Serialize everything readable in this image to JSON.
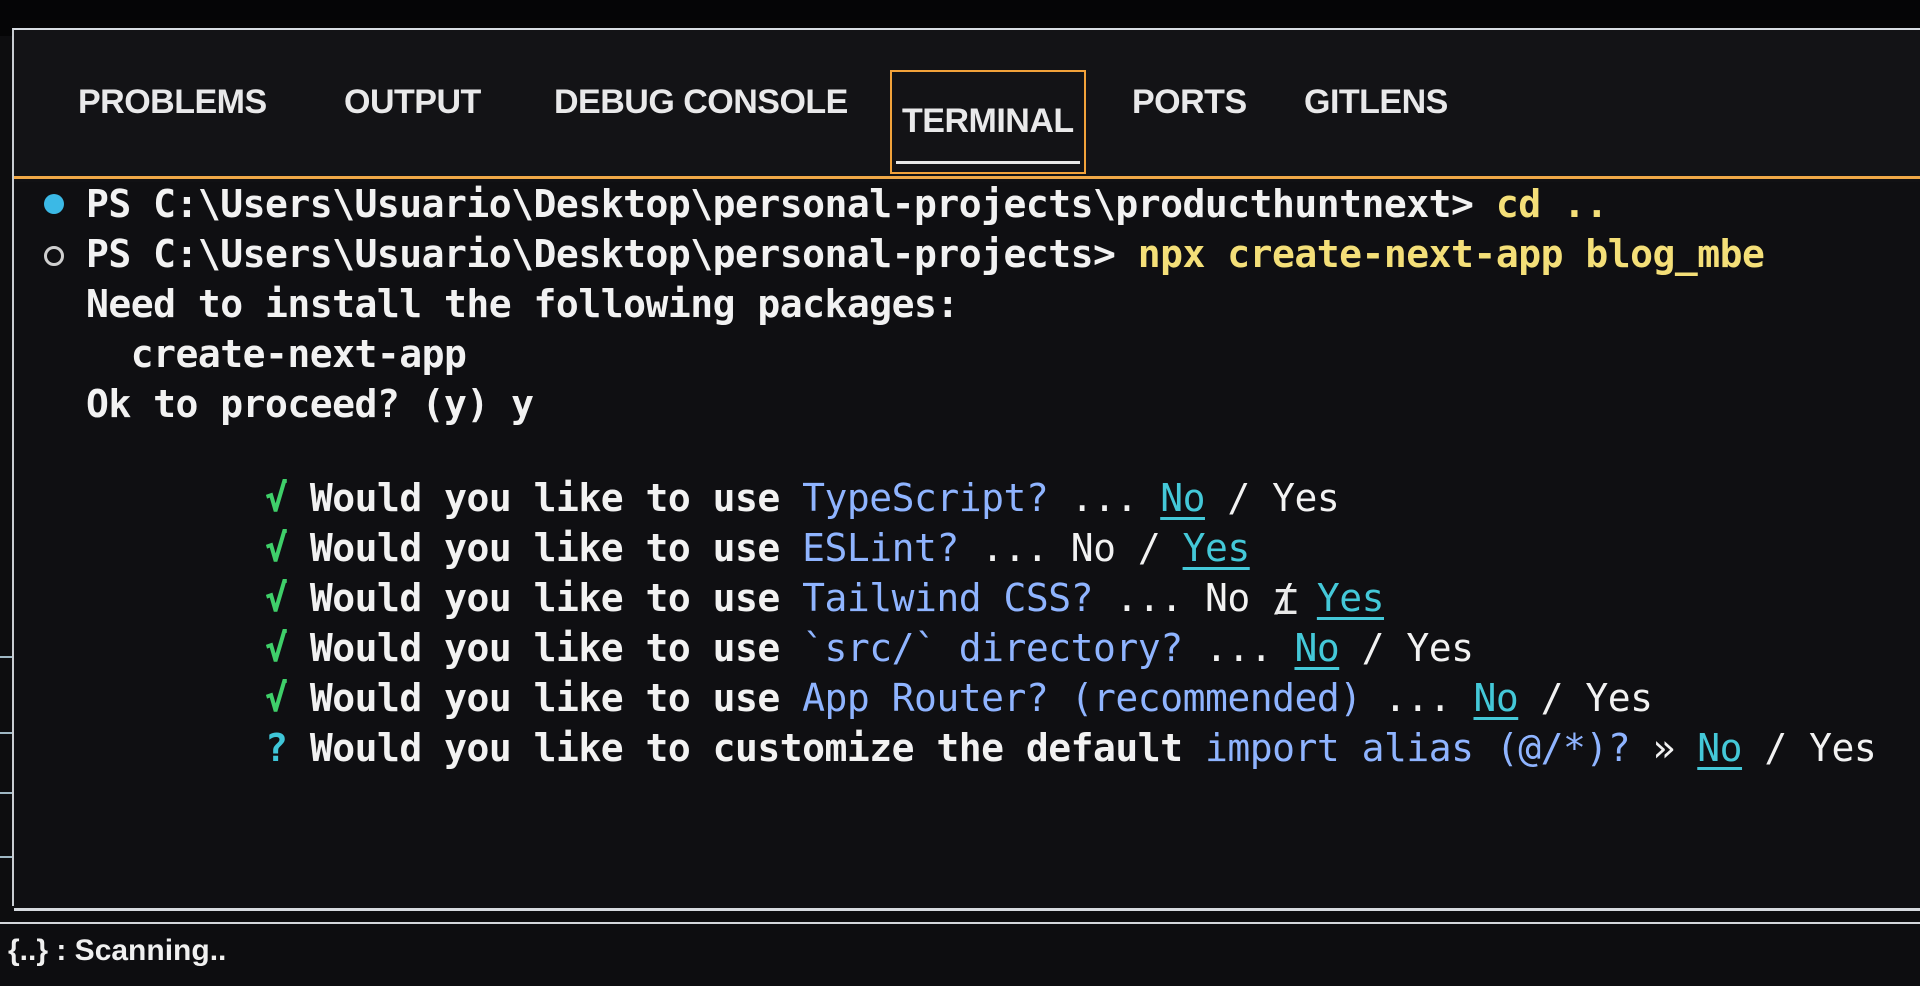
{
  "tabs": [
    {
      "label": "PROBLEMS"
    },
    {
      "label": "OUTPUT"
    },
    {
      "label": "DEBUG CONSOLE"
    },
    {
      "label": "TERMINAL",
      "active": true
    },
    {
      "label": "PORTS"
    },
    {
      "label": "GITLENS"
    }
  ],
  "terminal": {
    "line1": {
      "prompt": "PS C:\\Users\\Usuario\\Desktop\\personal-projects\\producthuntnext> ",
      "command": "cd .."
    },
    "line2": {
      "prompt": "PS C:\\Users\\Usuario\\Desktop\\personal-projects> ",
      "command": "npx create-next-app blog_mbe"
    },
    "line3": "Need to install the following packages:",
    "line4": "  create-next-app",
    "line5": "Ok to proceed? (y) y",
    "questions": [
      {
        "mark": "√",
        "pre": "Would you like to use ",
        "topic": "TypeScript?",
        "dots": " ... ",
        "no": "No",
        "sep": " / ",
        "yes": "Yes",
        "selected": "no"
      },
      {
        "mark": "√",
        "pre": "Would you like to use ",
        "topic": "ESLint?",
        "dots": " ... ",
        "no": "No",
        "sep": " / ",
        "yes": "Yes",
        "selected": "yes"
      },
      {
        "mark": "√",
        "pre": "Would you like to use ",
        "topic": "Tailwind CSS?",
        "dots": " ... ",
        "no": "No",
        "sep": " / ",
        "yes": "Yes",
        "selected": "yes"
      },
      {
        "mark": "√",
        "pre": "Would you like to use ",
        "topic": "`src/` directory?",
        "dots": " ... ",
        "no": "No",
        "sep": " / ",
        "yes": "Yes",
        "selected": "no"
      },
      {
        "mark": "√",
        "pre": "Would you like to use ",
        "topic": "App Router? (recommended)",
        "dots": " ... ",
        "no": "No",
        "sep": " / ",
        "yes": "Yes",
        "selected": "no"
      },
      {
        "mark": "?",
        "pre": "Would you like to customize the default ",
        "topic": "import alias (@/*)?",
        "dots": " » ",
        "no": "No",
        "sep": " / ",
        "yes": "Yes",
        "selected": "no"
      }
    ]
  },
  "status": {
    "text": "{..} : Scanning.."
  },
  "colors": {
    "accent": "#f0a847",
    "prompt_cmd": "#f4df78",
    "check": "#3fd06a",
    "selected": "#44c8d8"
  }
}
